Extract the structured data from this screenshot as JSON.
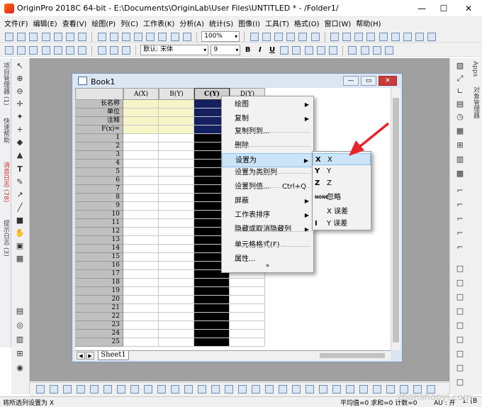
{
  "window": {
    "title": "OriginPro 2018C 64-bit - E:\\Documents\\OriginLab\\User Files\\UNTITLED * - /Folder1/",
    "minimize": "—",
    "maximize": "☐",
    "close": "✕"
  },
  "menubar": [
    "文件(F)",
    "编辑(E)",
    "查看(V)",
    "绘图(P)",
    "列(C)",
    "工作表(K)",
    "分析(A)",
    "统计(S)",
    "图像(I)",
    "工具(T)",
    "格式(O)",
    "窗口(W)",
    "帮助(H)"
  ],
  "toolbar": {
    "zoom": "100%",
    "font_name": "默认: 宋体",
    "font_size": "9",
    "bold": "B",
    "italic": "I",
    "underline": "U"
  },
  "left_panel": {
    "project_explorer": "项目管理器 (1)",
    "quick_help": "快速帮助",
    "message_log": "消息日志 (78)",
    "hint_log": "提示日志 (3)"
  },
  "right_panel": {
    "apps": "Apps",
    "object_manager": "对象管理器"
  },
  "book": {
    "title": "Book1",
    "sheet_tab": "Sheet1",
    "nav_prev": "◀",
    "nav_next": "▶"
  },
  "worksheet": {
    "columns": [
      "A(X)",
      "B(Y)",
      "C(Y)",
      "D(Y)"
    ],
    "label_rows": [
      "长名称",
      "单位",
      "注释",
      "F(x)="
    ],
    "rows": [
      "1",
      "2",
      "3",
      "4",
      "5",
      "6",
      "7",
      "8",
      "9",
      "10",
      "11",
      "12",
      "13",
      "14",
      "15",
      "16",
      "17",
      "18",
      "19",
      "20",
      "21",
      "22",
      "23",
      "24",
      "25"
    ]
  },
  "context_menu": {
    "items": [
      {
        "label": "绘图",
        "submenu": true
      },
      {
        "label": "复制",
        "submenu": true
      },
      {
        "label": "复制列到...",
        "submenu": false
      },
      {
        "label": "删除",
        "submenu": false
      },
      {
        "label": "设置为",
        "submenu": true,
        "highlighted": true
      },
      {
        "label": "设置为类别列",
        "submenu": false
      },
      {
        "label": "设置列值...",
        "shortcut": "Ctrl+Q"
      },
      {
        "label": "屏蔽",
        "submenu": true
      },
      {
        "label": "工作表排序",
        "submenu": true
      },
      {
        "label": "隐藏或取消隐藏列",
        "submenu": true
      },
      {
        "label": "单元格格式(F)...",
        "submenu": false
      },
      {
        "label": "属性...",
        "submenu": false
      }
    ],
    "more": "»"
  },
  "submenu": {
    "items": [
      {
        "icon": "X",
        "label": "X"
      },
      {
        "icon": "Y",
        "label": "Y"
      },
      {
        "icon": "Z",
        "label": "Z"
      },
      {
        "icon": "NONE",
        "label": "忽略"
      },
      {
        "icon": "",
        "label": "X 误差"
      },
      {
        "icon": "I",
        "label": "Y 误差"
      }
    ]
  },
  "statusbar": {
    "left": "将所选列设置为 X",
    "stats": "平均值=0 求和=0 计数=0",
    "au": "AU : 开",
    "misc": "1: [B"
  },
  "watermark": "zhanshaoyi.com",
  "colors": {
    "selected_column": "#000000",
    "label_row_fill": "#f5f5c8",
    "arrow": "#e8232a",
    "highlight": "#cce4f7"
  }
}
